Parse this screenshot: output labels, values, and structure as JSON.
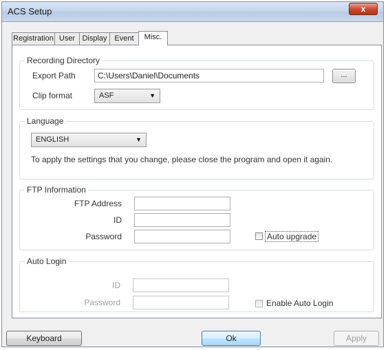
{
  "window": {
    "title": "ACS Setup",
    "close_glyph": "x"
  },
  "tabs": [
    {
      "label": "Registration",
      "active": false
    },
    {
      "label": "User",
      "active": false
    },
    {
      "label": "Display",
      "active": false
    },
    {
      "label": "Event",
      "active": false
    },
    {
      "label": "Misc.",
      "active": true
    }
  ],
  "recording": {
    "legend": "Recording Directory",
    "export_path_label": "Export Path",
    "export_path_value": "C:\\Users\\Daniel\\Documents",
    "browse_label": "...",
    "clip_format_label": "Clip format",
    "clip_format_value": "ASF"
  },
  "language": {
    "legend": "Language",
    "value": "ENGLISH",
    "note": "To apply the settings that you change, please close the program and open it again."
  },
  "ftp": {
    "legend": "FTP Information",
    "address_label": "FTP Address",
    "address_value": "",
    "id_label": "ID",
    "id_value": "",
    "password_label": "Password",
    "password_value": "",
    "auto_upgrade_label": "Auto upgrade",
    "auto_upgrade_checked": false
  },
  "auto_login": {
    "legend": "Auto Login",
    "id_label": "ID",
    "id_value": "",
    "password_label": "Password",
    "password_value": "",
    "enable_label": "Enable Auto Login",
    "enable_checked": false
  },
  "footer": {
    "keyboard_label": "Keyboard",
    "ok_label": "Ok",
    "apply_label": "Apply"
  },
  "icons": {
    "dropdown": "chevron-down-icon",
    "close": "close-icon"
  }
}
